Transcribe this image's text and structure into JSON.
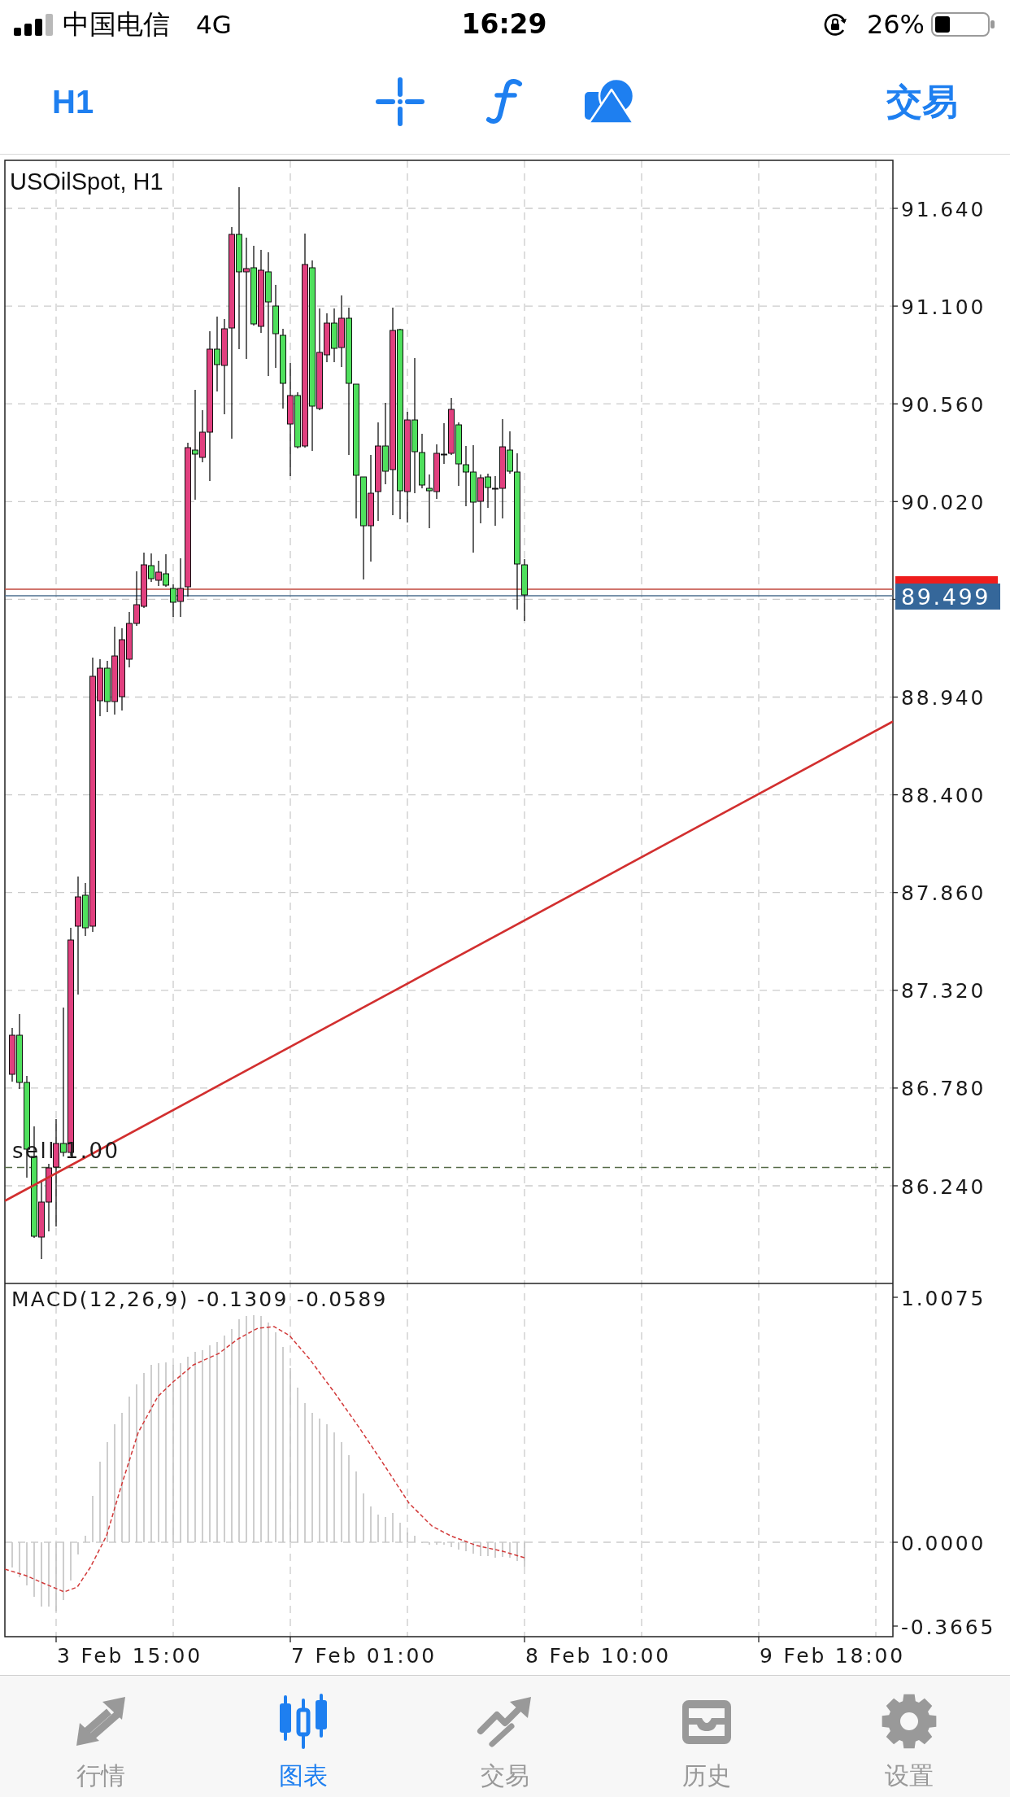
{
  "status_bar": {
    "carrier": "中国电信",
    "network": "4G",
    "time": "16:29",
    "battery": "26%"
  },
  "toolbar": {
    "timeframe": "H1",
    "trade": "交易"
  },
  "chart": {
    "title": "USOilSpot, H1",
    "price_axis": [
      "91.640",
      "91.100",
      "90.560",
      "90.020",
      "88.940",
      "88.400",
      "87.860",
      "87.320",
      "86.780",
      "86.240"
    ],
    "bid_price": "89.499",
    "order_label": "sell 1.00"
  },
  "macd": {
    "label": "MACD(12,26,9) -0.1309 -0.0589",
    "axis": [
      "1.0075",
      "0.0000",
      "-0.3665"
    ]
  },
  "time_axis": [
    "3 Feb 15:00",
    "7 Feb 01:00",
    "8 Feb 10:00",
    "9 Feb 18:00"
  ],
  "tab_bar": {
    "tabs": [
      {
        "label": "行情",
        "selected": false
      },
      {
        "label": "图表",
        "selected": true
      },
      {
        "label": "交易",
        "selected": false
      },
      {
        "label": "历史",
        "selected": false
      },
      {
        "label": "设置",
        "selected": false
      }
    ]
  }
}
